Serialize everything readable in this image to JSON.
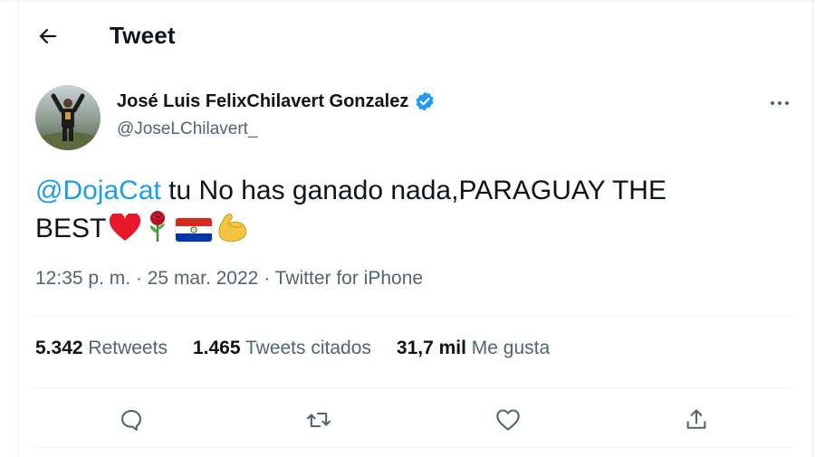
{
  "header": {
    "title": "Tweet"
  },
  "tweet": {
    "author_name": "José Luis FelixChilavert Gonzalez",
    "author_handle": "@JoseLChilavert_",
    "mention": "@DojaCat",
    "text_part1": " tu No has ganado nada,PARAGUAY THE",
    "text_part2": "BEST",
    "emojis": [
      "red-heart",
      "rose",
      "paraguay-flag",
      "flexed-biceps"
    ],
    "time": "12:35 p. m.",
    "sep": "·",
    "date": "25 mar. 2022",
    "source": "Twitter for iPhone"
  },
  "stats": {
    "retweets_count": "5.342",
    "retweets_label": "Retweets",
    "quotes_count": "1.465",
    "quotes_label": "Tweets citados",
    "likes_count": "31,7 mil",
    "likes_label": "Me gusta"
  },
  "colors": {
    "accent": "#1d9bf0",
    "text": "#0f1419",
    "secondary": "#536471",
    "divider": "#eff3f4",
    "heart": "#e8182b"
  }
}
